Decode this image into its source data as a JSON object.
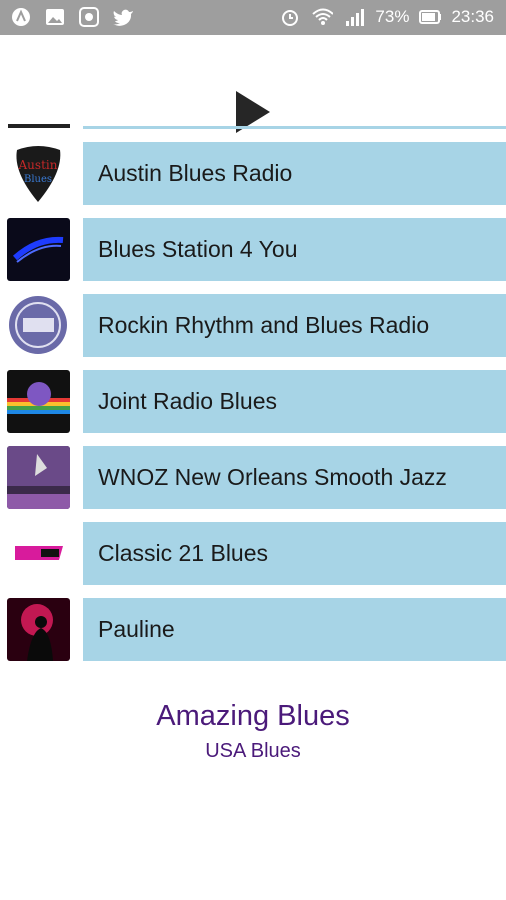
{
  "status": {
    "battery": "73%",
    "time": "23:36",
    "left_icons": [
      "app-icon",
      "image-icon",
      "radio-icon",
      "twitter-icon"
    ],
    "right_icons": [
      "alarm-icon",
      "wifi-icon",
      "signal-icon",
      "battery-icon"
    ]
  },
  "player": {
    "play_icon": "play-icon"
  },
  "stations": [
    {
      "name": "Austin Blues Radio",
      "color": "#c62828"
    },
    {
      "name": "Blues Station 4 You",
      "color": "#1e3cff"
    },
    {
      "name": "Rockin Rhythm and Blues Radio",
      "color": "#6a6aa8"
    },
    {
      "name": "Joint Radio Blues",
      "color": "#e53935"
    },
    {
      "name": "WNOZ New Orleans Smooth Jazz",
      "color": "#8e5aa8"
    },
    {
      "name": "Classic 21 Blues",
      "color": "#d81b9c"
    },
    {
      "name": "Pauline",
      "color": "#e91e63"
    }
  ],
  "footer": {
    "title": "Amazing Blues",
    "subtitle": "USA Blues"
  },
  "colors": {
    "row_bg": "#a7d4e6",
    "footer_text": "#4b1a7a",
    "status_bg": "#9e9e9e"
  }
}
